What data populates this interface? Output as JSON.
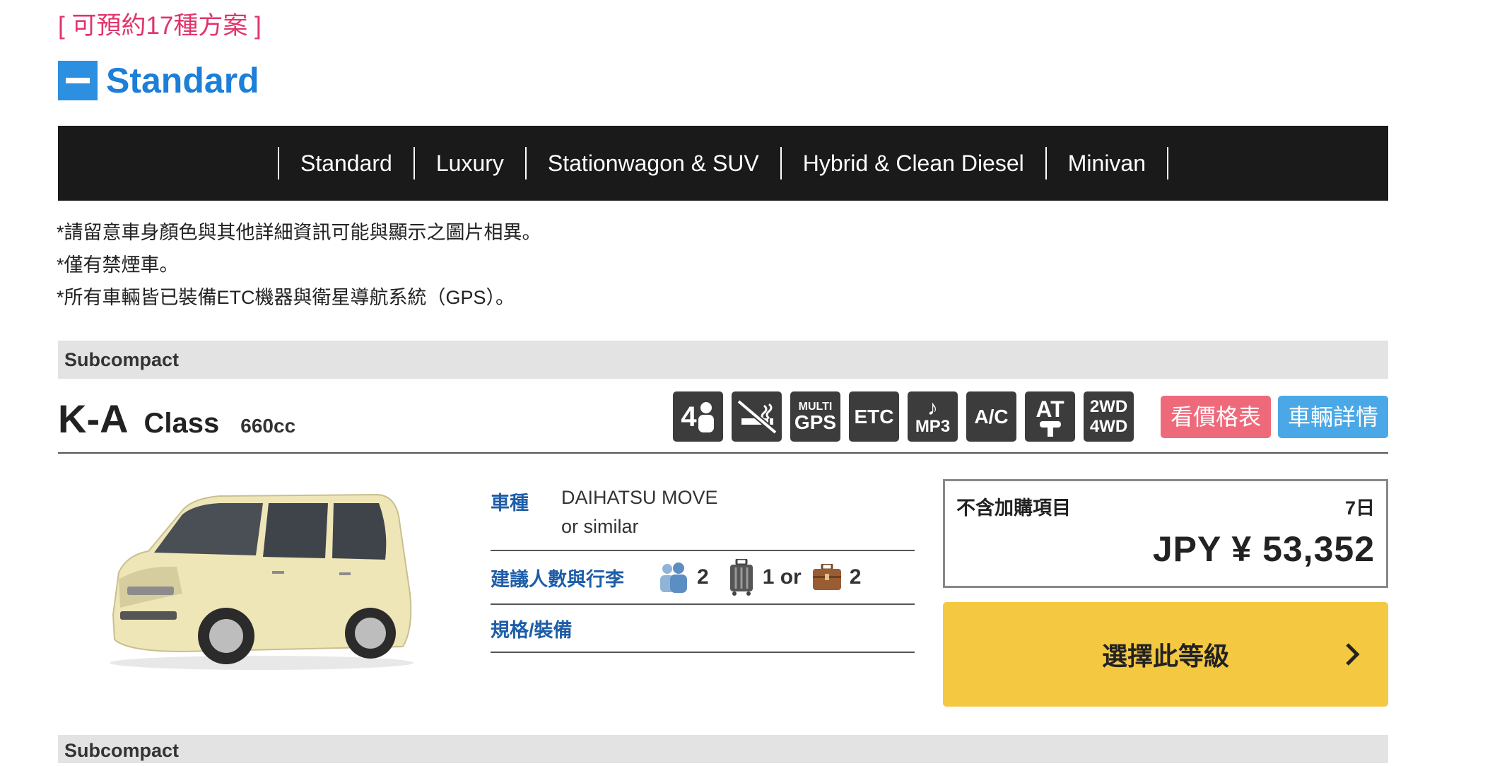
{
  "availability": "[ 可預約17種方案 ]",
  "section": {
    "title": "Standard"
  },
  "categories": [
    "Standard",
    "Luxury",
    "Stationwagon & SUV",
    "Hybrid & Clean Diesel",
    "Minivan"
  ],
  "notes": [
    "*請留意車身顏色與其他詳細資訊可能與顯示之圖片相異。",
    "*僅有禁煙車。",
    "*所有車輛皆已裝備ETC機器與衛星導航系統（GPS）。"
  ],
  "class_band": "Subcompact",
  "next_class_band": "Subcompact",
  "car": {
    "class_code": "K-A",
    "class_word": "Class",
    "engine": "660cc",
    "feature_icons": {
      "seats": "4",
      "multi": "MULTI",
      "gps": "GPS",
      "etc": "ETC",
      "mp3": "MP3",
      "ac": "A/C",
      "at": "AT",
      "wd2": "2WD",
      "wd4": "4WD"
    },
    "price_table_label": "看價格表",
    "details_label": "車輛詳情",
    "model_label": "車種",
    "model_name": "DAIHATSU MOVE",
    "model_note": "or similar",
    "capacity_label": "建議人數與行李",
    "passengers": "2",
    "large_bags": "1 or",
    "small_bags": "2",
    "equipment_label": "規格/裝備",
    "price_caption": "不含加購項目",
    "days": "7日",
    "price": "JPY ¥ 53,352",
    "select_label": "選擇此等級"
  },
  "colors": {
    "accent_pink": "#e0356b",
    "accent_blue": "#2d8fe0",
    "nav_bg": "#1a1a1a",
    "label_blue": "#1e5da8",
    "select_yellow": "#f5c842",
    "price_btn": "#ee6a7b",
    "detail_btn": "#4aa8e6"
  }
}
